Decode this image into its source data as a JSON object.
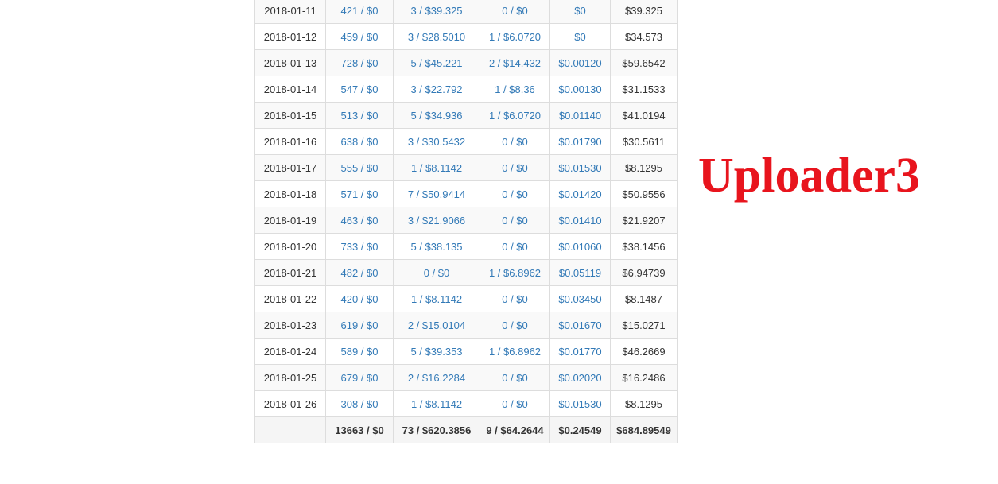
{
  "watermark": "Uploader3",
  "rows": [
    {
      "date": "2018-01-11",
      "views": "421 / $0",
      "sales": "3 / $39.325",
      "refunds": "0 / $0",
      "ads": "$0",
      "total": "$39.325"
    },
    {
      "date": "2018-01-12",
      "views": "459 / $0",
      "sales": "3 / $28.5010",
      "refunds": "1 / $6.0720",
      "ads": "$0",
      "total": "$34.573"
    },
    {
      "date": "2018-01-13",
      "views": "728 / $0",
      "sales": "5 / $45.221",
      "refunds": "2 / $14.432",
      "ads": "$0.00120",
      "total": "$59.6542"
    },
    {
      "date": "2018-01-14",
      "views": "547 / $0",
      "sales": "3 / $22.792",
      "refunds": "1 / $8.36",
      "ads": "$0.00130",
      "total": "$31.1533"
    },
    {
      "date": "2018-01-15",
      "views": "513 / $0",
      "sales": "5 / $34.936",
      "refunds": "1 / $6.0720",
      "ads": "$0.01140",
      "total": "$41.0194"
    },
    {
      "date": "2018-01-16",
      "views": "638 / $0",
      "sales": "3 / $30.5432",
      "refunds": "0 / $0",
      "ads": "$0.01790",
      "total": "$30.5611"
    },
    {
      "date": "2018-01-17",
      "views": "555 / $0",
      "sales": "1 / $8.1142",
      "refunds": "0 / $0",
      "ads": "$0.01530",
      "total": "$8.1295"
    },
    {
      "date": "2018-01-18",
      "views": "571 / $0",
      "sales": "7 / $50.9414",
      "refunds": "0 / $0",
      "ads": "$0.01420",
      "total": "$50.9556"
    },
    {
      "date": "2018-01-19",
      "views": "463 / $0",
      "sales": "3 / $21.9066",
      "refunds": "0 / $0",
      "ads": "$0.01410",
      "total": "$21.9207"
    },
    {
      "date": "2018-01-20",
      "views": "733 / $0",
      "sales": "5 / $38.135",
      "refunds": "0 / $0",
      "ads": "$0.01060",
      "total": "$38.1456"
    },
    {
      "date": "2018-01-21",
      "views": "482 / $0",
      "sales": "0 / $0",
      "refunds": "1 / $6.8962",
      "ads": "$0.05119",
      "total": "$6.94739"
    },
    {
      "date": "2018-01-22",
      "views": "420 / $0",
      "sales": "1 / $8.1142",
      "refunds": "0 / $0",
      "ads": "$0.03450",
      "total": "$8.1487"
    },
    {
      "date": "2018-01-23",
      "views": "619 / $0",
      "sales": "2 / $15.0104",
      "refunds": "0 / $0",
      "ads": "$0.01670",
      "total": "$15.0271"
    },
    {
      "date": "2018-01-24",
      "views": "589 / $0",
      "sales": "5 / $39.353",
      "refunds": "1 / $6.8962",
      "ads": "$0.01770",
      "total": "$46.2669"
    },
    {
      "date": "2018-01-25",
      "views": "679 / $0",
      "sales": "2 / $16.2284",
      "refunds": "0 / $0",
      "ads": "$0.02020",
      "total": "$16.2486"
    },
    {
      "date": "2018-01-26",
      "views": "308 / $0",
      "sales": "1 / $8.1142",
      "refunds": "0 / $0",
      "ads": "$0.01530",
      "total": "$8.1295"
    }
  ],
  "totals": {
    "date": "",
    "views": "13663 / $0",
    "sales": "73 / $620.3856",
    "refunds": "9 / $64.2644",
    "ads": "$0.24549",
    "total": "$684.89549"
  },
  "colors": {
    "link": "#337ab7",
    "watermark": "#e8141d",
    "border": "#dddddd"
  }
}
